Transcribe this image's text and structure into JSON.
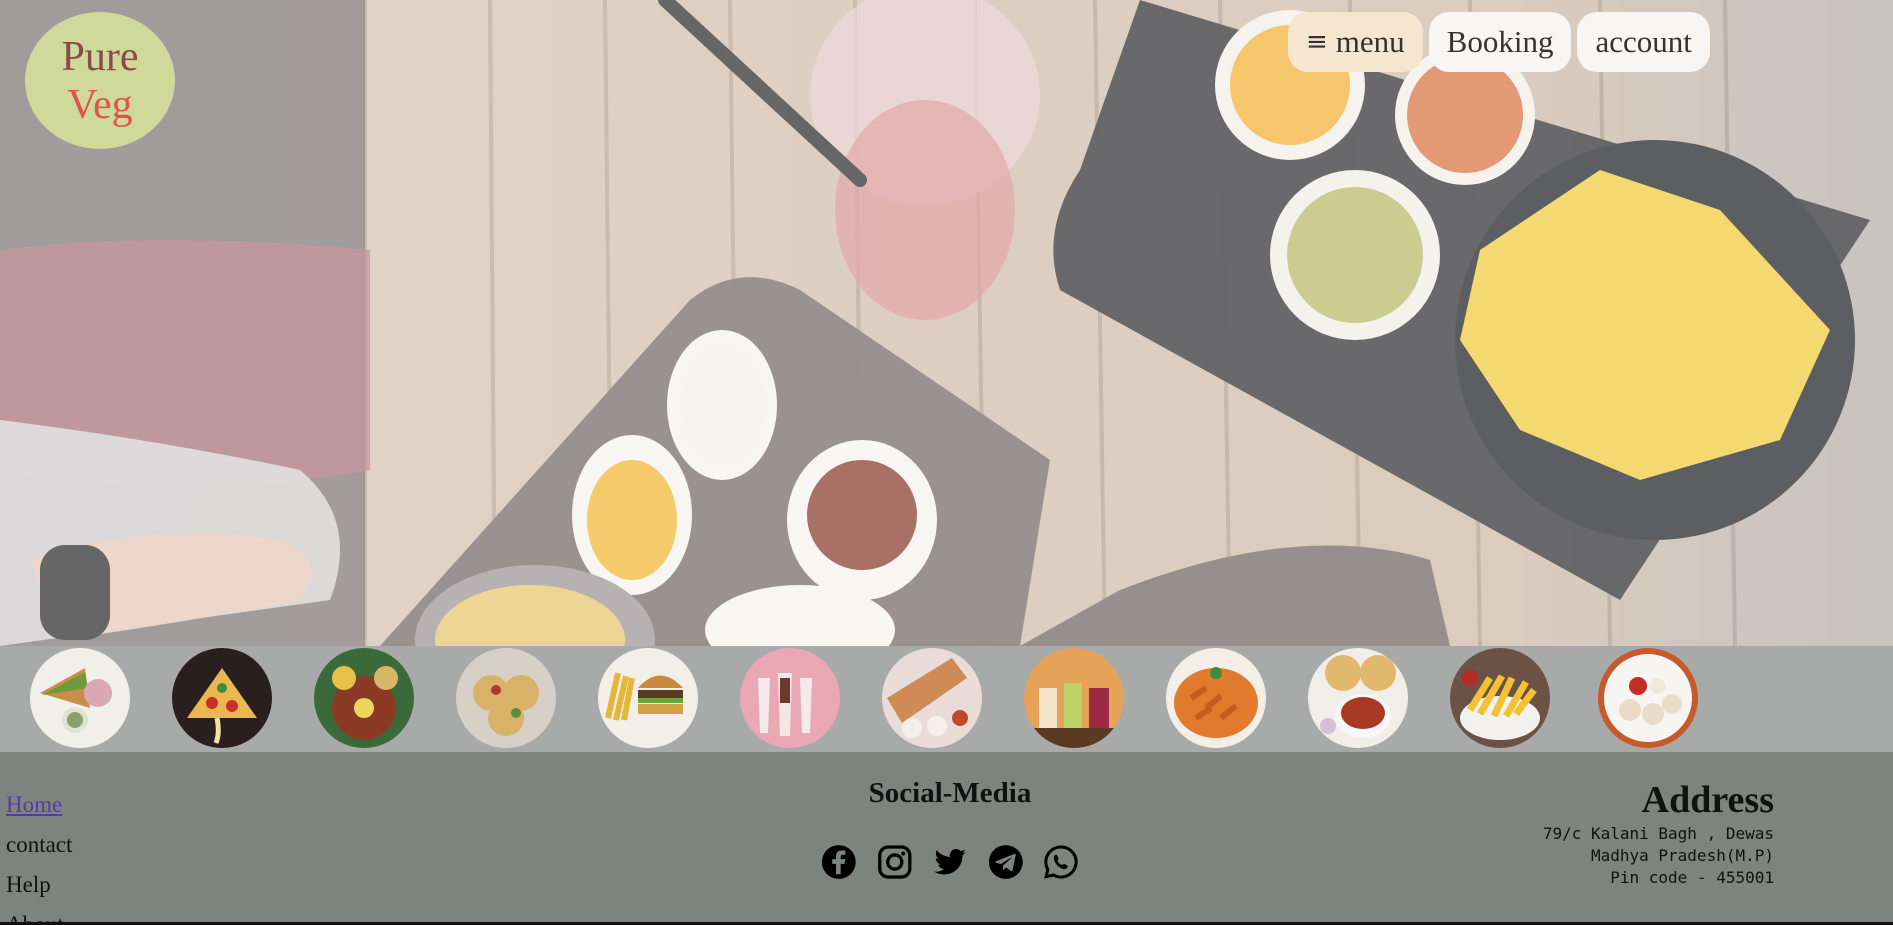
{
  "brand": {
    "line1": "Pure",
    "line2": "Veg"
  },
  "nav": {
    "menu_icon": "≡",
    "menu": "menu",
    "booking": "Booking",
    "account": "account"
  },
  "dish_icons": [
    "sandwich-icon",
    "pizza-icon",
    "thali-icon",
    "chaat-icon",
    "burger-icon",
    "milkshake-icon",
    "dosa-icon",
    "drinks-icon",
    "pasta-icon",
    "chole-bhature-icon",
    "fries-icon",
    "momos-icon"
  ],
  "footer": {
    "links": [
      "Home",
      "contact",
      "Help",
      "About"
    ],
    "social_title": "Social-Media",
    "social_icons": [
      "facebook-icon",
      "instagram-icon",
      "twitter-icon",
      "telegram-icon",
      "whatsapp-icon"
    ],
    "address_title": "Address",
    "address_lines": [
      "79/c Kalani Bagh , Dewas",
      "Madhya Pradesh(M.P)",
      "Pin code - 455001"
    ]
  }
}
